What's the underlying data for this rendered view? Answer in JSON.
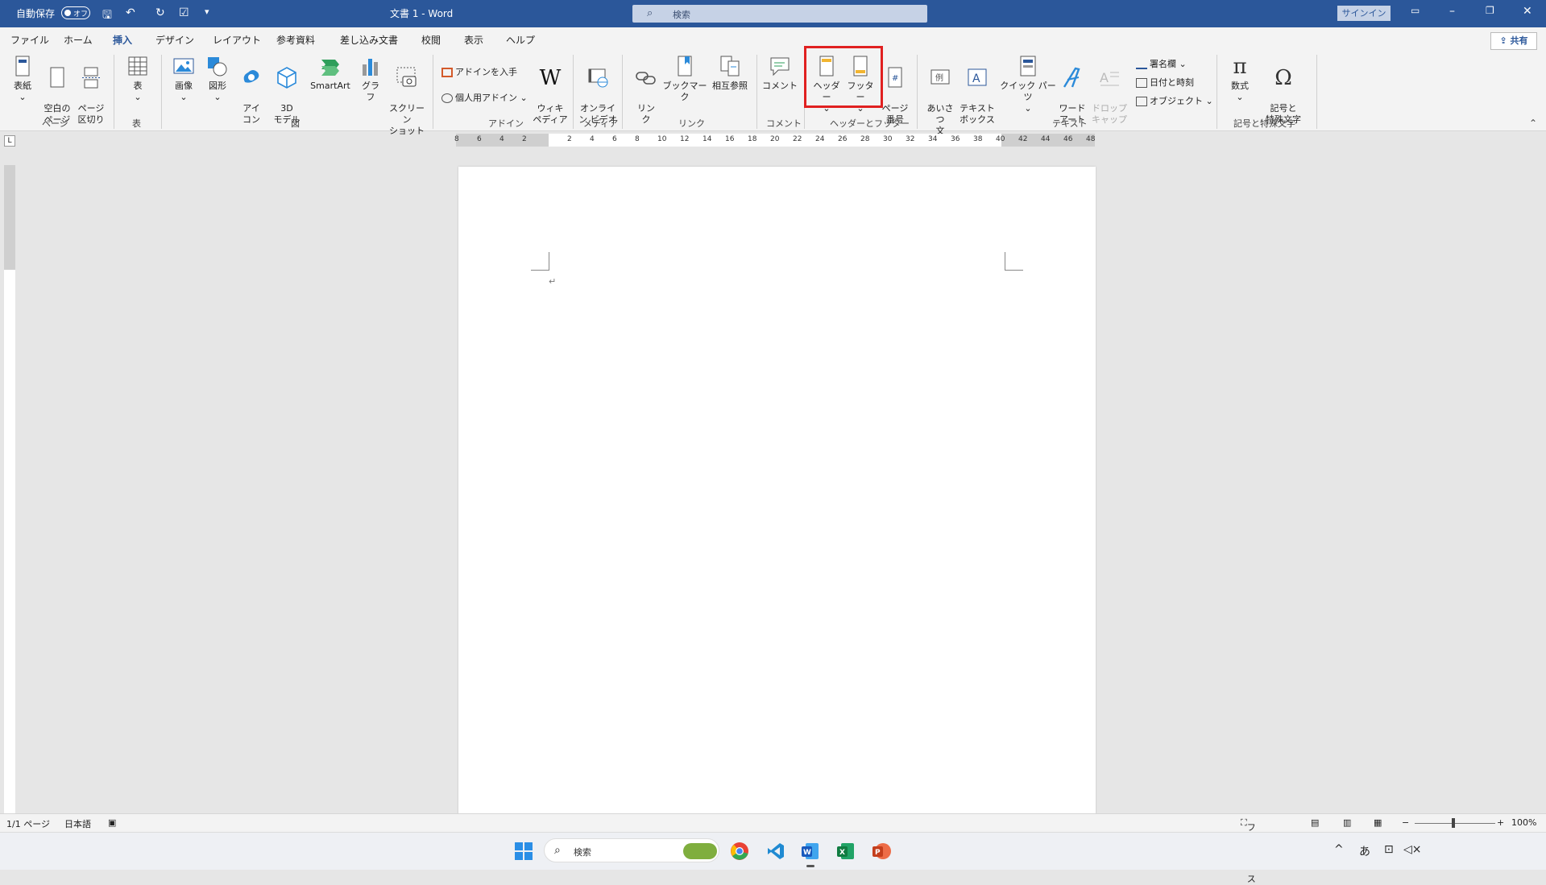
{
  "titlebar": {
    "autosave_label": "自動保存",
    "autosave_state": "オフ",
    "doc_title": "文書 1  -  Word",
    "search_placeholder": "検索",
    "signin_label": "サインイン",
    "accent_color": "#2b579a"
  },
  "tabs": [
    "ファイル",
    "ホーム",
    "挿入",
    "デザイン",
    "レイアウト",
    "参考資料",
    "差し込み文書",
    "校閲",
    "表示",
    "ヘルプ"
  ],
  "active_tab": "挿入",
  "share_label": "共有",
  "ribbon": {
    "pages": {
      "group": "ページ",
      "cover": "表紙",
      "blank": "空白の\nページ",
      "break": "ページ\n区切り"
    },
    "table": {
      "group": "表",
      "table": "表"
    },
    "illustrations": {
      "group": "図",
      "picture": "画像",
      "shapes": "図形",
      "icons": "アイ\nコン",
      "model3d": "3D\nモデル",
      "smartart": "SmartArt",
      "chart": "グラフ",
      "screenshot": "スクリーン\nショット"
    },
    "addins": {
      "group": "アドイン",
      "get": "アドインを入手",
      "my": "個人用アドイン",
      "wiki": "ウィキ\nペディア"
    },
    "media": {
      "group": "メディア",
      "video": "オンライ\nン ビデオ"
    },
    "links": {
      "group": "リンク",
      "link": "リン\nク",
      "bookmark": "ブックマーク",
      "crossref": "相互参照"
    },
    "comments": {
      "group": "コメント",
      "comment": "コメント"
    },
    "headerfooter": {
      "group": "ヘッダーとフッター",
      "header": "ヘッダー",
      "footer": "フッター",
      "pagenum": "ページ\n番号"
    },
    "text": {
      "group": "テキスト",
      "greeting": "あいさつ\n文",
      "textbox": "テキスト\nボックス",
      "quickparts": "クイック パーツ",
      "wordart": "ワード\nアート",
      "dropcap": "ドロップ\nキャップ",
      "signature": "署名欄",
      "datetime": "日付と時刻",
      "object": "オブジェクト"
    },
    "symbols": {
      "group": "記号と特殊文字",
      "equation": "数式",
      "symbol": "記号と\n特殊文字"
    }
  },
  "ruler": {
    "numbers": [
      "8",
      "6",
      "4",
      "2",
      "",
      "2",
      "4",
      "6",
      "8",
      "10",
      "12",
      "14",
      "16",
      "18",
      "20",
      "22",
      "24",
      "26",
      "28",
      "30",
      "32",
      "34",
      "36",
      "38",
      "40",
      "42",
      "44",
      "46",
      "48"
    ]
  },
  "statusbar": {
    "page": "1/1 ページ",
    "language": "日本語",
    "focus": "フォーカス",
    "zoom": "100%"
  },
  "taskbar": {
    "search_placeholder": "検索",
    "ime": "あ"
  }
}
